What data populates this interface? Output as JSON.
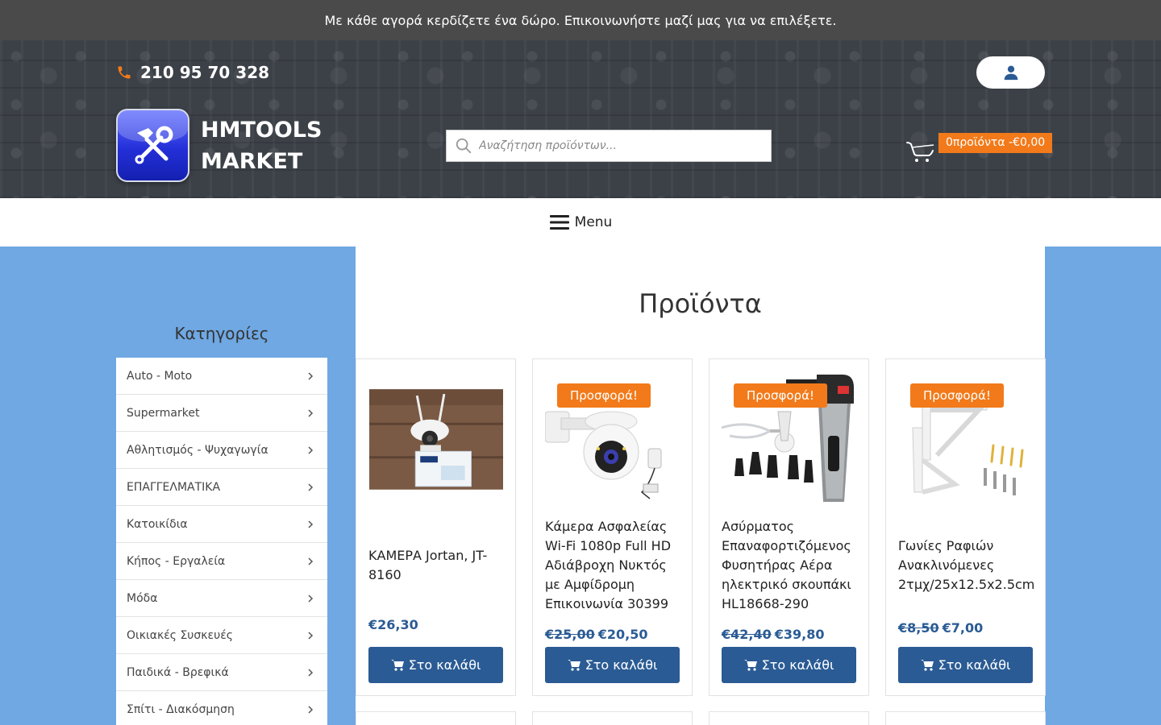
{
  "topbar": {
    "text": "Με κάθε αγορά κερδίζετε ένα δώρο. Επικοινωνήστε μαζί μας για να επιλέξετε."
  },
  "header": {
    "phone": "210 95 70 328",
    "brand_line1": "HMTOOLS",
    "brand_line2": "MARKET",
    "search_placeholder": "Αναζήτηση προϊόντων...",
    "cart_label": "0προϊόντα -€0,00",
    "icons": {
      "phone": "phone-icon",
      "account": "user-icon",
      "search": "search-icon",
      "cart": "cart-icon"
    },
    "colors": {
      "accent": "#f27a1a",
      "primary": "#2a5b94"
    }
  },
  "nav": {
    "menu_label": "Menu"
  },
  "sidebar": {
    "title": "Κατηγορίες",
    "items": [
      {
        "label": "Auto - Moto"
      },
      {
        "label": "Supermarket"
      },
      {
        "label": "Αθλητισμός - Ψυχαγωγία"
      },
      {
        "label": "ΕΠΑΓΓΕΛΜΑΤΙΚΑ"
      },
      {
        "label": "Κατοικίδια"
      },
      {
        "label": "Κήπος - Εργαλεία"
      },
      {
        "label": "Μόδα"
      },
      {
        "label": "Οικιακές Συσκευές"
      },
      {
        "label": "Παιδικά - Βρεφικά"
      },
      {
        "label": "Σπίτι - Διακόσμηση"
      }
    ]
  },
  "main": {
    "title": "Προϊόντα",
    "sale_badge": "Προσφορά!",
    "add_to_cart": "Στο καλάθι",
    "products": [
      {
        "name": "ΚΑΜΕΡΑ Jortan, JT-8160",
        "old_price": "",
        "price": "€26,30",
        "on_sale": false
      },
      {
        "name": "Κάμερα Ασφαλείας Wi-Fi 1080p Full HD Αδιάβροχη Νυκτός με Αμφίδρομη Επικοινωνία 30399",
        "old_price": "€25,00",
        "price": "€20,50",
        "on_sale": true
      },
      {
        "name": "Ασύρματος Επαναφορτιζόμενος Φυσητήρας Αέρα ηλεκτρικό σκουπάκι HL18668-290",
        "old_price": "€42,40",
        "price": "€39,80",
        "on_sale": true
      },
      {
        "name": "Γωνίες Ραφιών Ανακλινόμενες 2τμχ/25x12.5x2.5cm",
        "old_price": "€8,50",
        "price": "€7,00",
        "on_sale": true
      }
    ]
  }
}
